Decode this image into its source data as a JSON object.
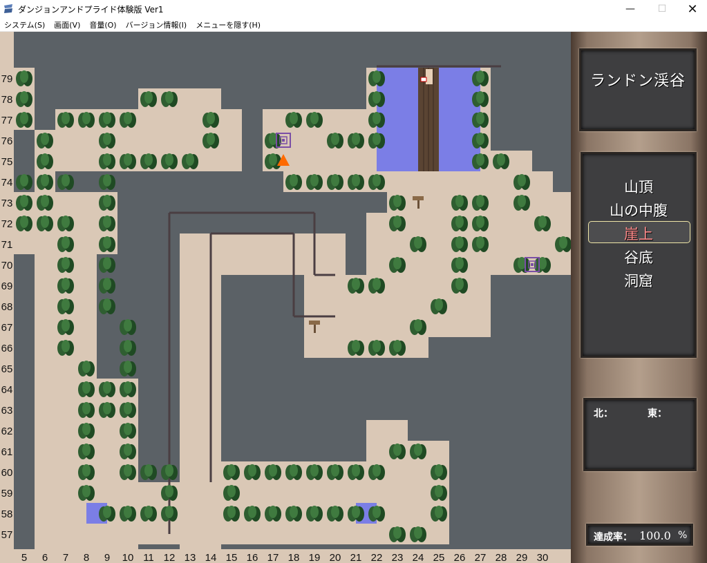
{
  "window": {
    "title": "ダンジョンアンドプライド体験版 Ver1",
    "minimize": "—",
    "maximize": "☐",
    "close": "✕"
  },
  "menu": [
    "システム(S)",
    "画面(V)",
    "音量(O)",
    "バージョン情報(I)",
    "メニューを隠す(H)"
  ],
  "map": {
    "row_labels": [
      "79",
      "78",
      "77",
      "76",
      "75",
      "74",
      "73",
      "72",
      "71",
      "70",
      "69",
      "68",
      "67",
      "66",
      "65",
      "64",
      "63",
      "62",
      "61",
      "60",
      "59",
      "58",
      "57"
    ],
    "col_labels": [
      "5",
      "6",
      "7",
      "8",
      "9",
      "10",
      "11",
      "12",
      "13",
      "14",
      "15",
      "16",
      "17",
      "18",
      "19",
      "20",
      "21",
      "22",
      "23",
      "24",
      "25",
      "26",
      "27",
      "28",
      "29",
      "30"
    ],
    "colors": {
      "background": "#5b6166",
      "floor": "#dac8b6",
      "water": "#7b7ee6",
      "tree": "#2f5e31",
      "wall": "#4a3e42",
      "bridge": "#5a4433",
      "player": "#ff6a00",
      "warp": "#7a4ea6"
    }
  },
  "sidebar": {
    "area_name": "ランドン渓谷",
    "floors": [
      "山頂",
      "山の中腹",
      "崖上",
      "谷底",
      "洞窟"
    ],
    "selected_floor": "崖上",
    "compass": {
      "north": "北：",
      "east": "東："
    },
    "achievement": {
      "label": "達成率：",
      "value": "100.0",
      "unit": "%"
    }
  }
}
